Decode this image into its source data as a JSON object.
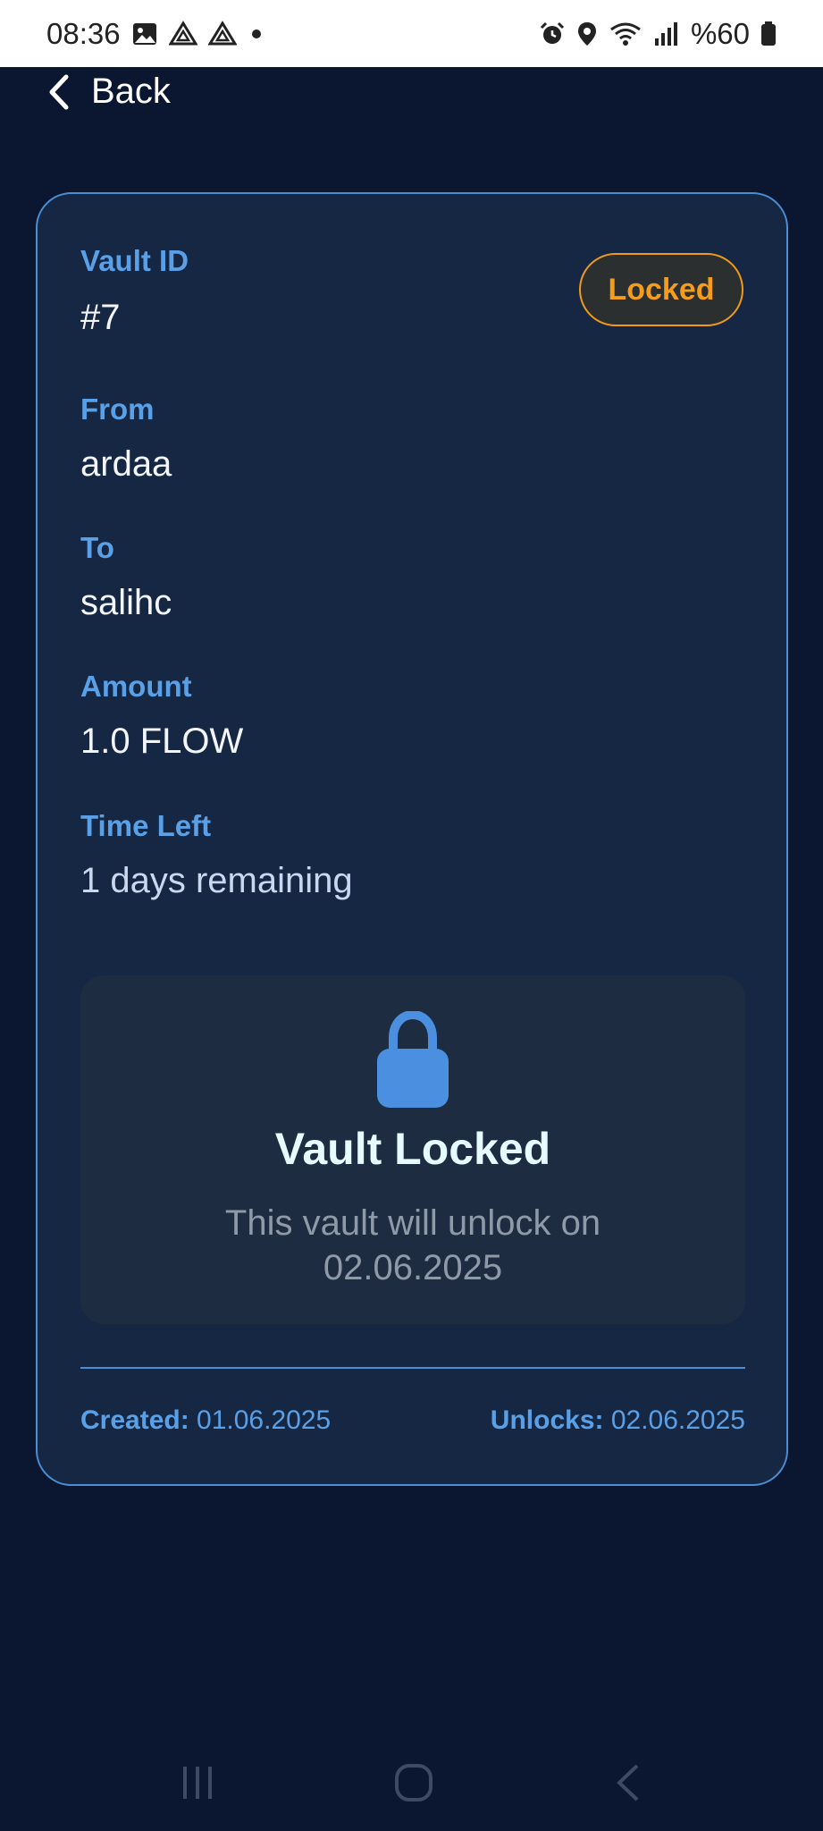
{
  "status_bar": {
    "time": "08:36",
    "battery_text": "%60",
    "icons_left": [
      "image-icon",
      "drive-icon",
      "drive-icon",
      "dot-icon"
    ],
    "icons_right": [
      "alarm-icon",
      "location-icon",
      "wifi-icon",
      "signal-icon",
      "battery-icon"
    ]
  },
  "nav": {
    "back_label": "Back"
  },
  "vault": {
    "id_label": "Vault ID",
    "id_value": "#7",
    "status": "Locked",
    "from_label": "From",
    "from_value": "ardaa",
    "to_label": "To",
    "to_value": "salihc",
    "amount_label": "Amount",
    "amount_value": "1.0 FLOW",
    "time_left_label": "Time Left",
    "time_left_value": "1 days remaining"
  },
  "lock_panel": {
    "icon": "lock-icon",
    "title": "Vault Locked",
    "message_line1": "This vault will unlock on",
    "message_line2": "02.06.2025"
  },
  "footer": {
    "created_label": "Created:",
    "created_value": "01.06.2025",
    "unlocks_label": "Unlocks:",
    "unlocks_value": "02.06.2025"
  },
  "colors": {
    "background": "#0b1730",
    "card": "#162744",
    "accent_blue": "#5aa0e6",
    "badge_orange": "#f59c1c"
  }
}
